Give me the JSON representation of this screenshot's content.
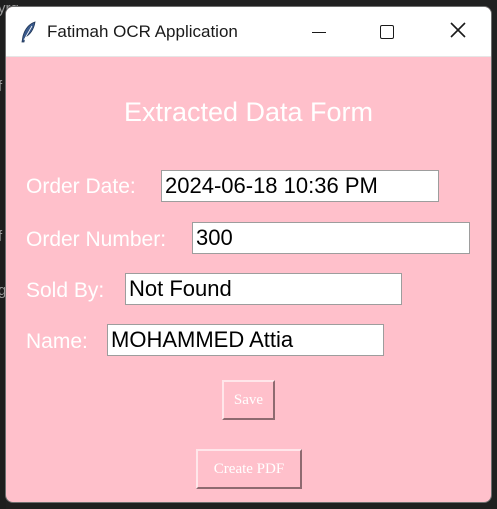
{
  "background": {
    "glyphs": [
      "yrg",
      "f",
      "f",
      "g"
    ]
  },
  "window": {
    "title": "Fatimah OCR Application",
    "icon": "feather-icon",
    "controls": {
      "minimize_icon": "minimize-icon",
      "maximize_icon": "maximize-icon",
      "close_icon": "close-icon"
    }
  },
  "form": {
    "title": "Extracted Data Form",
    "fields": [
      {
        "label": "Order Date:",
        "value": "2024-06-18 10:36 PM"
      },
      {
        "label": "Order Number:",
        "value": "300"
      },
      {
        "label": "Sold By:",
        "value": "Not Found"
      },
      {
        "label": "Name:",
        "value": "MOHAMMED Attia"
      }
    ],
    "save_label": "Save",
    "create_pdf_label": "Create PDF"
  },
  "colors": {
    "window_bg": "#ffc0cb",
    "label_text": "#ffffff",
    "titlebar_bg": "#ffffff"
  }
}
